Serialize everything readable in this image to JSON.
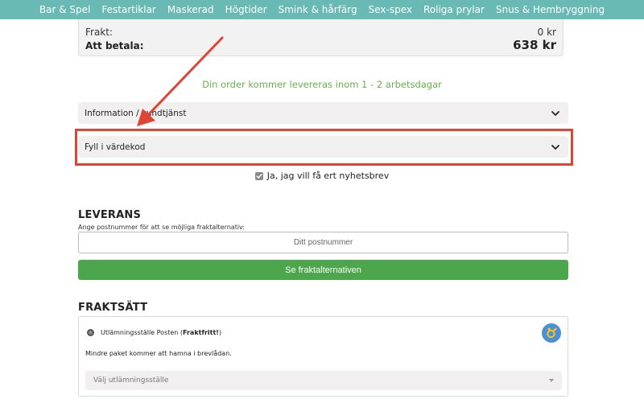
{
  "nav": {
    "items": [
      "Bar & Spel",
      "Festartiklar",
      "Maskerad",
      "Högtider",
      "Smink & hårfärg",
      "Sex-spex",
      "Roliga prylar",
      "Snus & Hembryggning"
    ]
  },
  "summary": {
    "shipping_label": "Frakt:",
    "shipping_value": "0 kr",
    "total_label": "Att betala:",
    "total_value": "638 kr"
  },
  "delivery_note": "Din order kommer levereras inom 1 - 2 arbetsdagar",
  "accordions": {
    "info_label": "Information / kundtjänst",
    "voucher_label": "Fyll i värdekod"
  },
  "newsletter_label": "Ja, jag vill få ert nyhetsbrev",
  "leverans": {
    "heading": "LEVERANS",
    "subtext": "Ange postnummer för att se möjliga fraktalternativ:",
    "postcode_placeholder": "Ditt postnummer",
    "button_label": "Se fraktalternativen"
  },
  "fraktsatt": {
    "heading": "FRAKTSÄTT",
    "option_prefix": "Utlämningsställe Posten (",
    "option_bold": "Fraktfritt!",
    "option_suffix": ")",
    "option_desc": "Mindre paket kommer att hamna i brevlådan.",
    "select_placeholder": "Välj utlämningsställe"
  },
  "colors": {
    "nav_bg": "#69b9b5",
    "accent_green": "#4ca64c",
    "delivery_green": "#6ab04c",
    "highlight_red": "#e04434",
    "posten_blue": "#4d8fd6",
    "posten_yellow": "#f5c518"
  }
}
